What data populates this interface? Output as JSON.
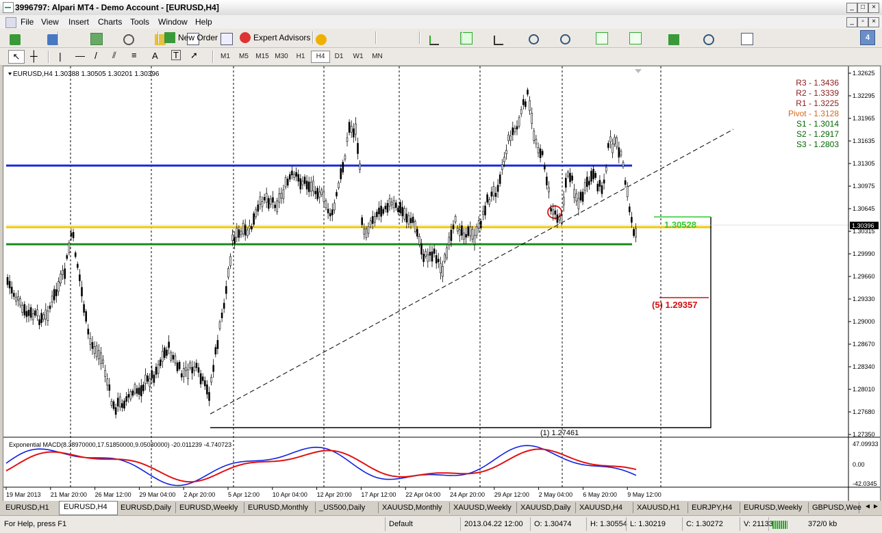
{
  "window": {
    "title": "3996797: Alpari MT4 - Demo Account - [EURUSD,H4]",
    "badge": "4"
  },
  "menu": [
    "File",
    "View",
    "Insert",
    "Charts",
    "Tools",
    "Window",
    "Help"
  ],
  "toolbar": {
    "new_order": "New Order",
    "expert_advisors": "Expert Advisors"
  },
  "timeframes": [
    "M1",
    "M5",
    "M15",
    "M30",
    "H1",
    "H4",
    "D1",
    "W1",
    "MN"
  ],
  "active_timeframe": "H4",
  "chart": {
    "header": "EURUSD,H4  1.30388 1.30505 1.30201 1.30396",
    "current_price": "1.30396",
    "price_axis": [
      "1.32625",
      "1.32295",
      "1.31965",
      "1.31635",
      "1.31305",
      "1.30975",
      "1.30645",
      "1.30315",
      "1.29990",
      "1.29660",
      "1.29330",
      "1.29000",
      "1.28670",
      "1.28340",
      "1.28010",
      "1.27680",
      "1.27350"
    ],
    "date_axis": [
      "19 Mar 2013",
      "21 Mar 20:00",
      "26 Mar 12:00",
      "29 Mar 04:00",
      "2 Apr 20:00",
      "5 Apr 12:00",
      "10 Apr 04:00",
      "12 Apr 20:00",
      "17 Apr 12:00",
      "22 Apr 04:00",
      "24 Apr 20:00",
      "29 Apr 12:00",
      "2 May 04:00",
      "6 May 20:00",
      "9 May 12:00"
    ],
    "pivots": [
      {
        "label": "R3 - 1.3436",
        "color": "#8b1a1a"
      },
      {
        "label": "R2 - 1.3339",
        "color": "#8b1a1a"
      },
      {
        "label": "R1 - 1.3225",
        "color": "#8b1a1a"
      },
      {
        "label": "Pivot - 1.3128",
        "color": "#d2691e"
      },
      {
        "label": "S1 - 1.3014",
        "color": "#006400"
      },
      {
        "label": "S2 - 1.2917",
        "color": "#006400"
      },
      {
        "label": "S3 - 1.2803",
        "color": "#006400"
      }
    ],
    "level_green": "1.30528",
    "level_red": "(5) 1.29357",
    "level_low": "(1) 1.27461",
    "macd_label": "Exponential MACD(8.38970000,17.51850000,9.05030000) -20.011239 -4.740723",
    "macd_axis": [
      "47.09933",
      "0.00",
      "-42.0345"
    ]
  },
  "tabs": [
    "EURUSD,H1",
    "EURUSD,H4",
    "EURUSD,Daily",
    "EURUSD,Weekly",
    "EURUSD,Monthly",
    "_US500,Daily",
    "XAUUSD,Monthly",
    "XAUUSD,Weekly",
    "XAUUSD,Daily",
    "XAUUSD,H4",
    "XAUUSD,H1",
    "EURJPY,H4",
    "EURUSD,Weekly",
    "GBPUSD,Wee"
  ],
  "active_tab": "EURUSD,H4",
  "status": {
    "help": "For Help, press F1",
    "profile": "Default",
    "time": "2013.04.22 12:00",
    "open": "O: 1.30474",
    "high": "H: 1.30554",
    "low": "L: 1.30219",
    "close": "C: 1.30272",
    "volume": "V: 21133",
    "traffic": "372/0 kb"
  }
}
